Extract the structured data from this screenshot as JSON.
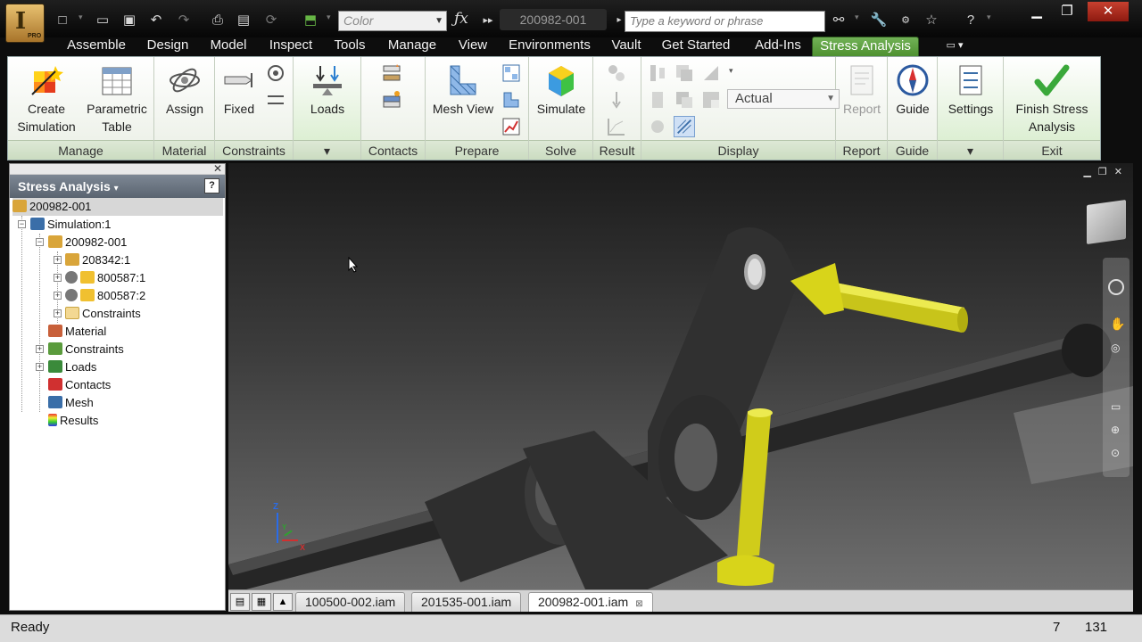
{
  "title_bar": {
    "app_badge": "PRO",
    "color_combo": "Color",
    "document_title": "200982-001",
    "search_placeholder": "Type a keyword or phrase"
  },
  "ribbon_tabs": [
    {
      "label": "Assemble"
    },
    {
      "label": "Design"
    },
    {
      "label": "Model"
    },
    {
      "label": "Inspect"
    },
    {
      "label": "Tools"
    },
    {
      "label": "Manage"
    },
    {
      "label": "View"
    },
    {
      "label": "Environments"
    },
    {
      "label": "Vault"
    },
    {
      "label": "Get Started"
    },
    {
      "label": "Add-Ins"
    },
    {
      "label": "Stress Analysis",
      "active": true
    }
  ],
  "ribbon": {
    "manage": {
      "label": "Manage",
      "create_simulation": "Create Simulation",
      "parametric_table": "Parametric Table"
    },
    "material": {
      "label": "Material",
      "assign": "Assign"
    },
    "constraints": {
      "label": "Constraints",
      "fixed": "Fixed"
    },
    "loads": {
      "label": "Loads"
    },
    "contacts": {
      "label": "Contacts"
    },
    "prepare": {
      "label": "Prepare",
      "mesh_view": "Mesh View"
    },
    "solve": {
      "label": "Solve",
      "simulate": "Simulate"
    },
    "result": {
      "label": "Result"
    },
    "display": {
      "label": "Display",
      "display_mode": "Actual"
    },
    "report": {
      "label": "Report",
      "report": "Report"
    },
    "guide": {
      "label": "Guide",
      "guide": "Guide"
    },
    "settings": {
      "settings": "Settings"
    },
    "exit": {
      "label": "Exit",
      "finish": "Finish Stress Analysis"
    }
  },
  "browser": {
    "title": "Stress Analysis",
    "tree": {
      "root": "200982-001",
      "simulation": "Simulation:1",
      "assembly": "200982-001",
      "part_208342": "208342:1",
      "part_800587_1": "800587:1",
      "part_800587_2": "800587:2",
      "constraints_folder": "Constraints",
      "material": "Material",
      "constraints": "Constraints",
      "loads": "Loads",
      "contacts": "Contacts",
      "mesh": "Mesh",
      "results": "Results"
    }
  },
  "viewport": {
    "axis_z": "Z",
    "axis_x": "X",
    "axis_y": "Y"
  },
  "document_tabs": [
    {
      "label": "100500-002.iam"
    },
    {
      "label": "201535-001.iam"
    },
    {
      "label": "200982-001.iam",
      "active": true
    }
  ],
  "status_bar": {
    "text": "Ready",
    "count_1": "7",
    "count_2": "131"
  },
  "colors": {
    "ribbon_accent": "#5a9b3c",
    "load_arrow": "#d8d41a",
    "model_body": "#2b2b2b"
  }
}
